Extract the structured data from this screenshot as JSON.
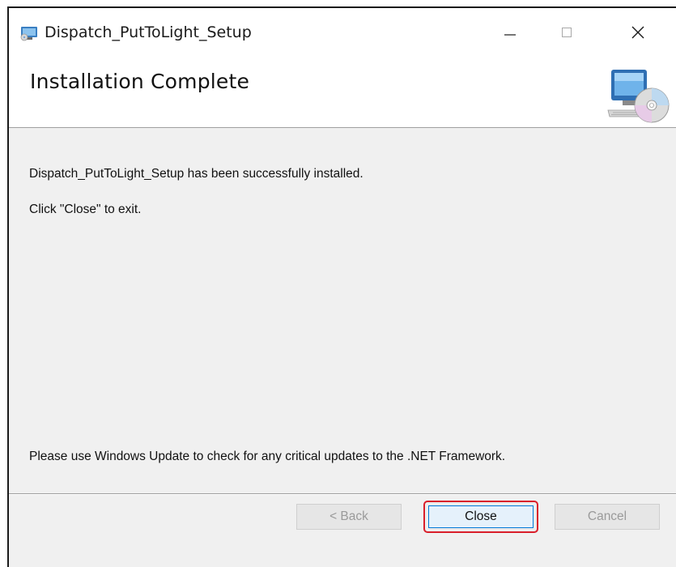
{
  "window": {
    "title": "Dispatch_PutToLight_Setup",
    "controls": {
      "minimize": "—",
      "maximize": "☐",
      "close": "✕"
    }
  },
  "banner": {
    "title": "Installation Complete",
    "icon": "computer-cd-icon"
  },
  "body": {
    "message_success": "Dispatch_PutToLight_Setup has been successfully installed.",
    "message_exit": "Click \"Close\" to exit.",
    "message_update": "Please use Windows Update to check for any critical updates to the .NET Framework."
  },
  "buttons": {
    "back": "< Back",
    "close": "Close",
    "cancel": "Cancel"
  },
  "colors": {
    "highlight": "#d91e2a",
    "focus": "#0078d7"
  }
}
